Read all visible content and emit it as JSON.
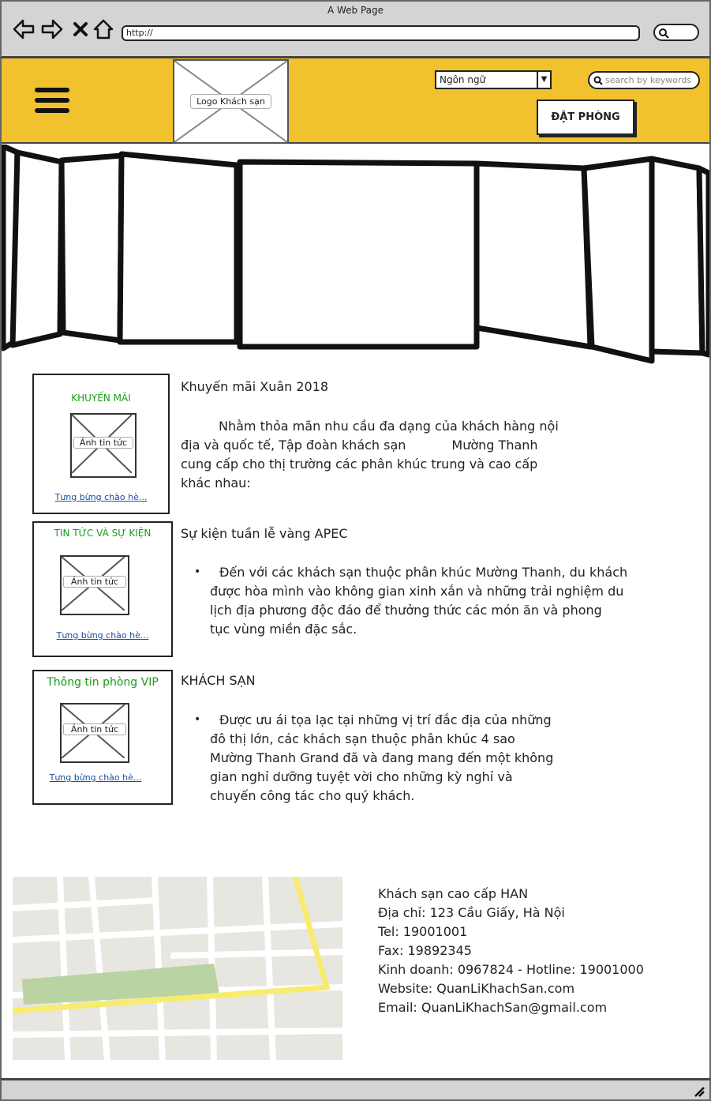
{
  "browser": {
    "window_title": "A Web Page",
    "url": "http://",
    "back_icon": "arrow-left-icon",
    "forward_icon": "arrow-right-icon",
    "close_icon": "x-icon",
    "home_icon": "home-icon"
  },
  "header": {
    "logo_label": "Logo Khách sạn",
    "language_select": "Ngôn ngữ",
    "search_placeholder": "search by keywords",
    "book_button": "ĐẶT PHÒNG",
    "accent_color": "#f2c12e"
  },
  "news": [
    {
      "card_title": "KHUYẾN MÃI",
      "image_label": "Ảnh tin tức",
      "link": "Tưng bừng chào hè...",
      "title": "Khuyến mãi Xuân 2018",
      "body": [
        "Nhằm thỏa mãn nhu cầu đa dạng của khách hàng nội",
        "địa và quốc tế, Tập đoàn khách sạn",
        "Mường Thanh",
        "cung cấp cho thị trường các phân khúc trung và cao cấp",
        "khác nhau:"
      ]
    },
    {
      "card_title": "TIN TỨC VÀ SỰ KIỆN",
      "image_label": "Ảnh tin tức",
      "link": "Tưng bừng chào hè...",
      "title": "Sự kiện tuần lễ vàng APEC",
      "body": [
        "Đến với các khách sạn thuộc phân khúc Mường Thanh, du khách",
        "được hòa mình vào không gian xinh xắn và những trải nghiệm du",
        "lịch địa phương độc đáo để thưởng thức các món ăn và phong",
        "tục vùng miền đặc sắc."
      ]
    },
    {
      "card_title": "Thông tin phòng VIP",
      "image_label": "Ảnh tin tức",
      "link": "Tưng bừng chào hè...",
      "title": "KHÁCH SẠN",
      "body": [
        "Được ưu ái tọa lạc tại những vị trí đắc địa của những",
        "đô thị lớn, các khách sạn thuộc phân khúc 4 sao",
        "Mường Thanh Grand đã và đang mang đến một không",
        "gian nghỉ dưỡng tuyệt vời cho những kỳ nghỉ và",
        "chuyến công tác cho quý khách."
      ]
    }
  ],
  "contact": [
    "Khách sạn cao cấp HAN",
    "Địa chỉ: 123 Cầu Giấy, Hà Nội",
    "Tel: 19001001",
    "Fax: 19892345",
    "Kinh doanh: 0967824 - Hotline: 19001000",
    "Website: QuanLiKhachSan.com",
    "Email: QuanLiKhachSan@gmail.com"
  ],
  "footer": {
    "resize_icon": "resize-grip-icon"
  }
}
